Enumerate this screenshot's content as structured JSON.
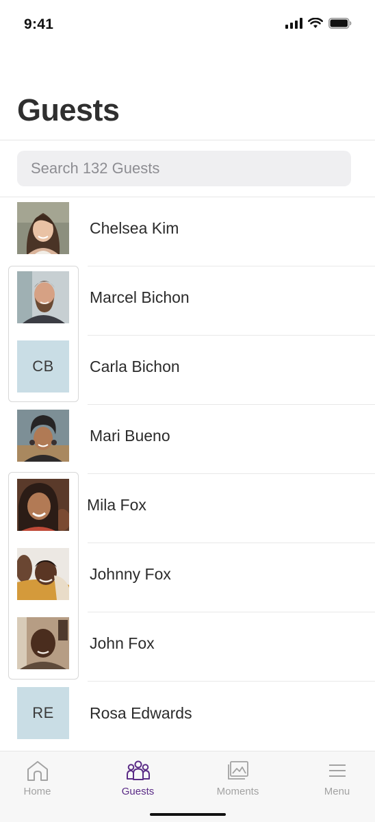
{
  "status_bar": {
    "time": "9:41"
  },
  "header": {
    "title": "Guests"
  },
  "search": {
    "placeholder": "Search 132 Guests"
  },
  "guests": [
    {
      "name": "Chelsea Kim",
      "avatar": "photo",
      "initials": ""
    },
    {
      "name": "Marcel Bichon",
      "avatar": "photo",
      "initials": ""
    },
    {
      "name": "Carla Bichon",
      "avatar": "initials",
      "initials": "CB"
    },
    {
      "name": "Mari Bueno",
      "avatar": "photo",
      "initials": ""
    },
    {
      "name": "Mila Fox",
      "avatar": "photo",
      "initials": ""
    },
    {
      "name": "Johnny Fox",
      "avatar": "photo",
      "initials": ""
    },
    {
      "name": "John Fox",
      "avatar": "photo",
      "initials": ""
    },
    {
      "name": "Rosa Edwards",
      "avatar": "initials",
      "initials": "RE"
    }
  ],
  "tabs": [
    {
      "label": "Home",
      "icon": "home-icon",
      "active": false
    },
    {
      "label": "Guests",
      "icon": "guests-icon",
      "active": true
    },
    {
      "label": "Moments",
      "icon": "moments-icon",
      "active": false
    },
    {
      "label": "Menu",
      "icon": "menu-icon",
      "active": false
    }
  ],
  "colors": {
    "accent": "#5a2b86",
    "initials_bg": "#c9dde5",
    "search_bg": "#efeff1"
  }
}
